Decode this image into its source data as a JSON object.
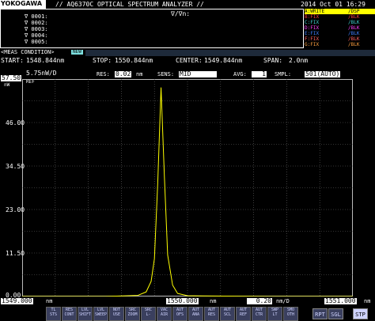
{
  "header": {
    "brand": "YOKOGAWA",
    "title": "// AQ6370C OPTICAL SPECTRUM ANALYZER //",
    "date": "2014 Oct 01 16:29",
    "marker_label": "∇/∇n:",
    "marker_rows": [
      "∇ 0001:",
      "∇ 0002:",
      "∇ 0003:",
      "∇ 0004:",
      "∇ 0005:"
    ]
  },
  "traces": [
    {
      "label": "A:WRITE",
      "mode": "/DSP",
      "color": "#ffff00"
    },
    {
      "label": "B:FIX",
      "mode": "/BLK",
      "color": "#ff4040"
    },
    {
      "label": "C:FIX",
      "mode": "/BLK",
      "color": "#40d0d0"
    },
    {
      "label": "D:FIX",
      "mode": "/BLK",
      "color": "#ff40ff"
    },
    {
      "label": "E:FIX",
      "mode": "/BLK",
      "color": "#4080ff"
    },
    {
      "label": "F:FIX",
      "mode": "/BLK",
      "color": "#ff6060"
    },
    {
      "label": "G:FIX",
      "mode": "/BLK",
      "color": "#ffa040"
    }
  ],
  "meas": {
    "condition_label": "<MEAS CONDITION>",
    "new_badge": "NEW",
    "start_label": "START:",
    "start": "1548.844nm",
    "stop_label": "STOP:",
    "stop": "1550.844nm",
    "center_label": "CENTER:",
    "center": "1549.844nm",
    "span_label": "SPAN:",
    "span": "2.0nm"
  },
  "settings": {
    "ref_value": "57.50",
    "ref_unit": "nW",
    "scale": "5.75nW/D",
    "res_label": "RES:",
    "res": "0.02",
    "res_unit": "nm",
    "sens_label": "SENS:",
    "sens": "MID",
    "avg_label": "AVG:",
    "avg": "1",
    "smpl_label": "SMPL:",
    "smpl": "501(AUTO)",
    "ref_tag": "REF"
  },
  "chart_data": {
    "type": "line",
    "xlabel": "nm",
    "ylabel": "nW",
    "xlim": [
      1549.0,
      1551.0
    ],
    "ylim": [
      0,
      57.5
    ],
    "y_ticks": [
      "57.50",
      "46.00",
      "34.50",
      "23.00",
      "11.50",
      "0.00"
    ],
    "series": [
      {
        "color": "#ffff00",
        "x": [
          1549.0,
          1549.5,
          1549.7,
          1549.75,
          1549.78,
          1549.8,
          1549.82,
          1549.84,
          1549.86,
          1549.88,
          1549.91,
          1549.94,
          1550.0,
          1550.5,
          1551.0
        ],
        "y": [
          0,
          0,
          0.3,
          1.2,
          4.0,
          10.0,
          30.0,
          55.2,
          32.0,
          11.0,
          3.0,
          0.8,
          0.2,
          0,
          0
        ]
      }
    ]
  },
  "footer": {
    "start": "1549.000",
    "start_unit": "nm",
    "center": "1550.000",
    "center_unit": "nm",
    "scale": "0.20",
    "scale_unit": "nm/D",
    "stop": "1551.000",
    "stop_unit": "nm"
  },
  "softkeys": [
    [
      "TL",
      "STS"
    ],
    [
      "RES",
      "CONT"
    ],
    [
      "LVL",
      "SHIFT"
    ],
    [
      "LVL",
      "SWEEP"
    ],
    [
      "NOT",
      "USE"
    ],
    [
      "SRC",
      "ZOOM"
    ],
    [
      "SRC",
      "L-"
    ],
    [
      "VAC",
      "AIR"
    ],
    [
      "AUT",
      "OFS"
    ],
    [
      "AUT",
      "ANA"
    ],
    [
      "AUT",
      "RES"
    ],
    [
      "AUT",
      "SCL"
    ],
    [
      "AUT",
      "REF"
    ],
    [
      "AUT",
      "CTR"
    ],
    [
      "SWP",
      "LT"
    ],
    [
      "SMO",
      "OTH"
    ]
  ],
  "buttons": {
    "rpt": "RPT",
    "sgl": "SGL",
    "stp": "STP"
  }
}
